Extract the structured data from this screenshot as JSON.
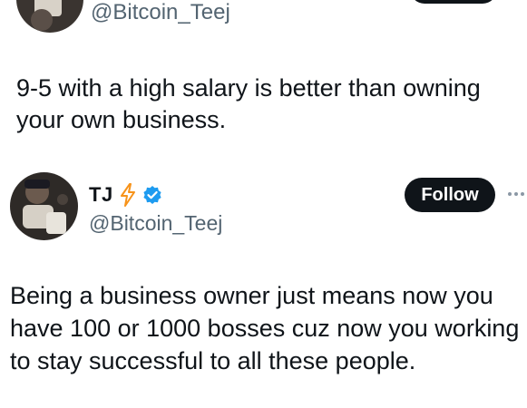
{
  "top_tweet": {
    "handle": "@Bitcoin_Teej",
    "text": "9-5 with a high salary is better than owning your own business."
  },
  "quoted_tweet": {
    "display_name": "TJ",
    "handle": "@Bitcoin_Teej",
    "follow_label": "Follow",
    "text": "Being a business owner just means now you have 100 or 1000 bosses cuz now you working to stay successful to all these people."
  },
  "icons": {
    "lightning": "lightning-icon",
    "verified": "verified-badge-icon",
    "more": "more-options-icon"
  },
  "colors": {
    "text": "#0f1419",
    "secondary_text": "#536471",
    "follow_button": "#0f1419",
    "verified_blue": "#1d9bf0",
    "lightning_orange": "#f7931a"
  }
}
